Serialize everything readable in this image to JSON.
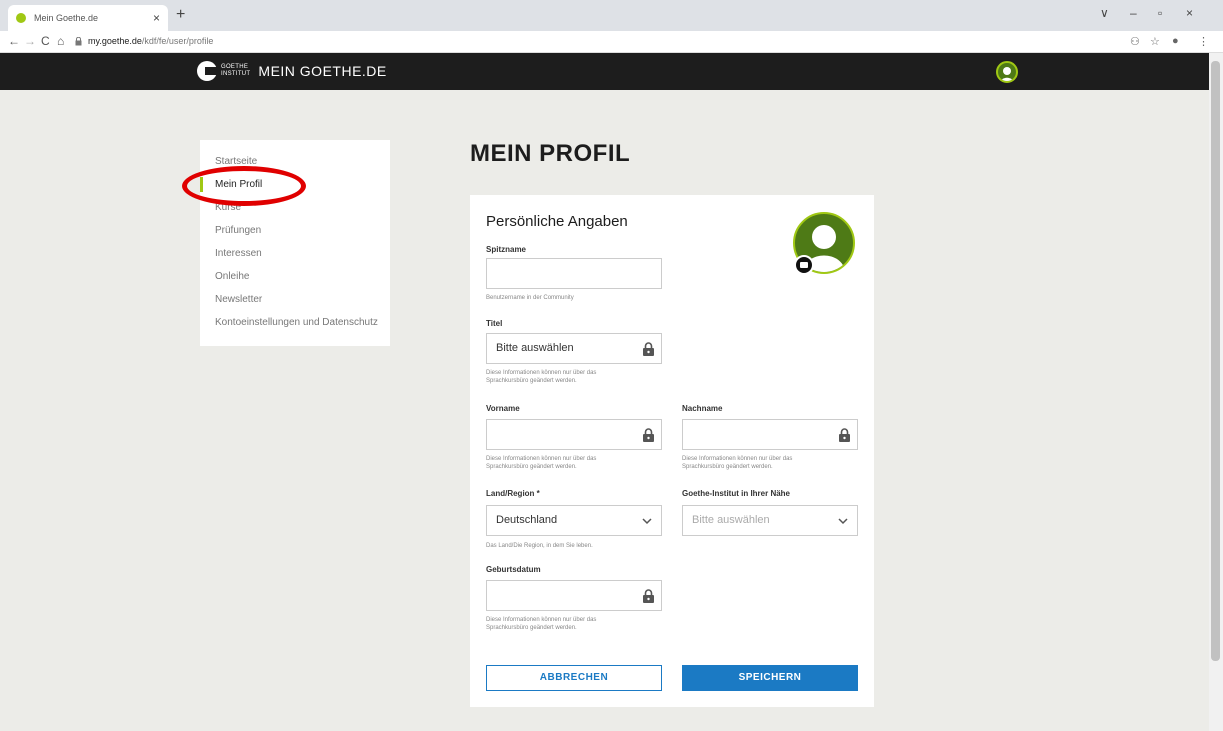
{
  "browser": {
    "tab_title": "Mein Goethe.de",
    "tab_close": "×",
    "new_tab": "+",
    "url_host": "my.goethe.de",
    "url_path": "/kdf/fe/user/profile",
    "nav_back": "←",
    "nav_forward": "→",
    "nav_reload": "C",
    "nav_home": "⌂",
    "win_min": "–",
    "win_max": "▫",
    "win_close": "×",
    "win_dropdown": "∨"
  },
  "site": {
    "logo_line1": "GOETHE",
    "logo_line2": "INSTITUT",
    "brand": "MEIN GOETHE.DE"
  },
  "sidebar": {
    "items": [
      {
        "label": "Startseite",
        "active": false
      },
      {
        "label": "Mein Profil",
        "active": true
      },
      {
        "label": "Kurse",
        "active": false
      },
      {
        "label": "Prüfungen",
        "active": false
      },
      {
        "label": "Interessen",
        "active": false
      },
      {
        "label": "Onleihe",
        "active": false
      },
      {
        "label": "Newsletter",
        "active": false
      },
      {
        "label": "Kontoeinstellungen und Datenschutz",
        "active": false
      }
    ]
  },
  "main": {
    "title": "MEIN PROFIL",
    "section_title": "Persönliche Angaben",
    "spitzname": {
      "label": "Spitzname",
      "value": "",
      "hint": "Benutzername in der Community"
    },
    "titel": {
      "label": "Titel",
      "value": "Bitte auswählen",
      "hint1": "Diese Informationen können nur über das",
      "hint2": "Sprachkursbüro geändert werden."
    },
    "vorname": {
      "label": "Vorname",
      "value": "",
      "hint1": "Diese Informationen können nur über das",
      "hint2": "Sprachkursbüro geändert werden."
    },
    "nachname": {
      "label": "Nachname",
      "value": "",
      "hint1": "Diese Informationen können nur über das",
      "hint2": "Sprachkursbüro geändert werden."
    },
    "land": {
      "label": "Land/Region *",
      "value": "Deutschland",
      "hint": "Das Land/Die Region, in dem Sie leben."
    },
    "institut": {
      "label": "Goethe-Institut in Ihrer Nähe",
      "placeholder": "Bitte auswählen"
    },
    "geburtsdatum": {
      "label": "Geburtsdatum",
      "value": "",
      "hint1": "Diese Informationen können nur über das",
      "hint2": "Sprachkursbüro geändert werden."
    },
    "cancel_label": "ABBRECHEN",
    "save_label": "SPEICHERN"
  },
  "colors": {
    "accent_green": "#a0c814",
    "button_blue": "#1b7ac4",
    "header_black": "#1d1d1d",
    "annotation_red": "#e00000"
  }
}
